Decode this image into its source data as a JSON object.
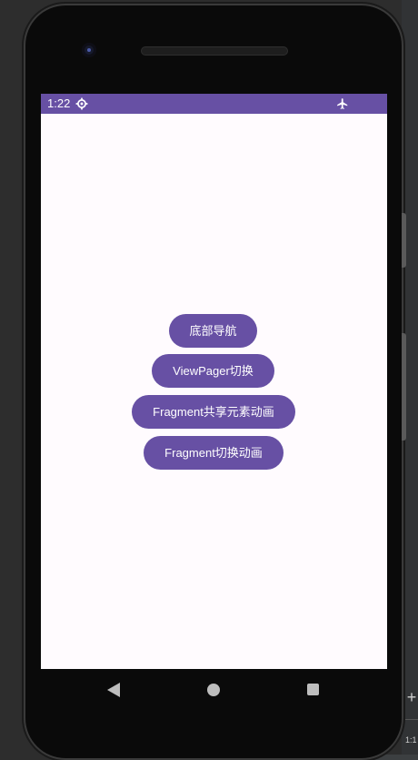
{
  "status_bar": {
    "time": "1:22",
    "left_icon": "settings-gear-icon",
    "right_icon": "airplane-mode-icon",
    "color": "#6750a4"
  },
  "buttons": {
    "bottom_nav": "底部导航",
    "viewpager": "ViewPager切换",
    "fragment_shared": "Fragment共享元素动画",
    "fragment_switch": "Fragment切换动画"
  },
  "nav_bar": {
    "back_icon": "back-triangle-icon",
    "home_icon": "home-circle-icon",
    "recents_icon": "recents-square-icon"
  },
  "ide": {
    "plus_label": "+",
    "mini_label": "1:1"
  },
  "colors": {
    "accent": "#6750a4",
    "screen_bg": "#fffbfe"
  }
}
